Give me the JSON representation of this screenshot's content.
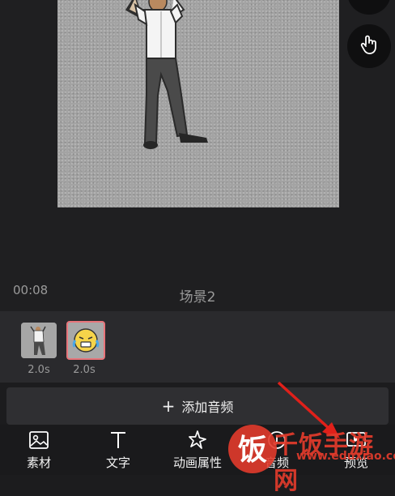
{
  "preview": {
    "time": "00:08",
    "scene_name": "场景2"
  },
  "timeline": {
    "clips": [
      {
        "duration": "2.0s",
        "selected": false
      },
      {
        "duration": "2.0s",
        "selected": true
      }
    ]
  },
  "add_audio": {
    "plus": "+",
    "label": "添加音频"
  },
  "toolbar": {
    "items": [
      {
        "label": "素材",
        "icon": "image-icon"
      },
      {
        "label": "文字",
        "icon": "text-icon"
      },
      {
        "label": "动画属性",
        "icon": "sparkle-icon"
      },
      {
        "label": "音频",
        "icon": "audio-icon"
      },
      {
        "label": "预览",
        "icon": "preview-icon"
      }
    ]
  },
  "watermark": {
    "brand": "千饭手游网",
    "url": "www.eduxiao.com",
    "logo_char": "饭"
  },
  "colors": {
    "background": "#1c1c1e",
    "timeline_bg": "#2a2a2d",
    "selected_clip_border": "#e8747a",
    "annotation_arrow": "#e0201a",
    "watermark": "#e23b2c"
  }
}
